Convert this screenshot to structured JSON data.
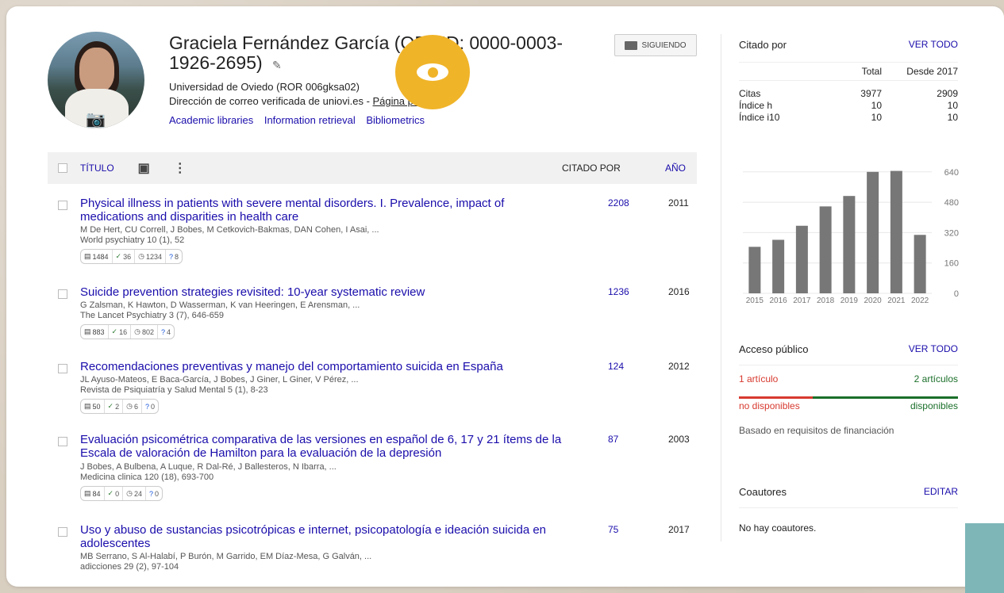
{
  "profile": {
    "name": "Graciela Fernández García (ORCID: 0000-0003-1926-2695)",
    "affiliation": "Universidad de Oviedo (ROR 006gksa02)",
    "email_line": "Dirección de correo verificada de uniovi.es - ",
    "homepage_label": "Página principal",
    "interests": [
      "Academic libraries",
      "Information retrieval",
      "Bibliometrics"
    ],
    "follow_label": "SIGUIENDO"
  },
  "table": {
    "title_header": "TÍTULO",
    "cited_header": "CITADO POR",
    "year_header": "AÑO"
  },
  "articles": [
    {
      "title": "Physical illness in patients with severe mental disorders. I. Prevalence, impact of medications and disparities in health care",
      "authors": "M De Hert, CU Correll, J Bobes, M Cetkovich-Bakmas, DAN Cohen, I Asai, ...",
      "venue": "World psychiatry 10 (1), 52",
      "cited": "2208",
      "year": "2011",
      "badges": [
        "1484",
        "36",
        "1234",
        "8"
      ]
    },
    {
      "title": "Suicide prevention strategies revisited: 10-year systematic review",
      "authors": "G Zalsman, K Hawton, D Wasserman, K van Heeringen, E Arensman, ...",
      "venue": "The Lancet Psychiatry 3 (7), 646-659",
      "cited": "1236",
      "year": "2016",
      "badges": [
        "883",
        "16",
        "802",
        "4"
      ]
    },
    {
      "title": "Recomendaciones preventivas y manejo del comportamiento suicida en España",
      "authors": "JL Ayuso-Mateos, E Baca-García, J Bobes, J Giner, L Giner, V Pérez, ...",
      "venue": "Revista de Psiquiatría y Salud Mental 5 (1), 8-23",
      "cited": "124",
      "year": "2012",
      "badges": [
        "50",
        "2",
        "6",
        "0"
      ]
    },
    {
      "title": "Evaluación psicométrica comparativa de las versiones en español de 6, 17 y 21 ítems de la Escala de valoración de Hamilton para la evaluación de la depresión",
      "authors": "J Bobes, A Bulbena, A Luque, R Dal-Ré, J Ballesteros, N Ibarra, ...",
      "venue": "Medicina clinica 120 (18), 693-700",
      "cited": "87",
      "year": "2003",
      "badges": [
        "84",
        "0",
        "24",
        "0"
      ]
    },
    {
      "title": "Uso y abuso de sustancias psicotrópicas e internet, psicopatología e ideación suicida en adolescentes",
      "authors": "MB Serrano, S Al-Halabí, P Burón, M Garrido, EM Díaz-Mesa, G Galván, ...",
      "venue": "adicciones 29 (2), 97-104",
      "cited": "75",
      "year": "2017"
    }
  ],
  "sidebar": {
    "cited_by_title": "Citado por",
    "view_all": "VER TODO",
    "col_total": "Total",
    "col_since": "Desde 2017",
    "rows": [
      {
        "label": "Citas",
        "total": "3977",
        "since": "2909"
      },
      {
        "label": "Índice h",
        "total": "10",
        "since": "10"
      },
      {
        "label": "Índice i10",
        "total": "10",
        "since": "10"
      }
    ],
    "access_title": "Acceso público",
    "access_view_all": "VER TODO",
    "access_left_count": "1 artículo",
    "access_right_count": "2 artículos",
    "access_left_label": "no disponibles",
    "access_right_label": "disponibles",
    "access_note": "Basado en requisitos de financiación",
    "access_colors": {
      "unavailable": "#d73a2f",
      "available": "#1b6f2a"
    },
    "coauthors_title": "Coautores",
    "coauthors_edit": "EDITAR",
    "coauthors_none": "No hay coautores."
  },
  "chart_data": {
    "type": "bar",
    "categories": [
      "2015",
      "2016",
      "2017",
      "2018",
      "2019",
      "2020",
      "2021",
      "2022"
    ],
    "values": [
      245,
      282,
      356,
      458,
      513,
      640,
      645,
      308
    ],
    "yticks": [
      0,
      160,
      320,
      480,
      640
    ],
    "ylim": [
      0,
      660
    ],
    "color": "#777777"
  }
}
